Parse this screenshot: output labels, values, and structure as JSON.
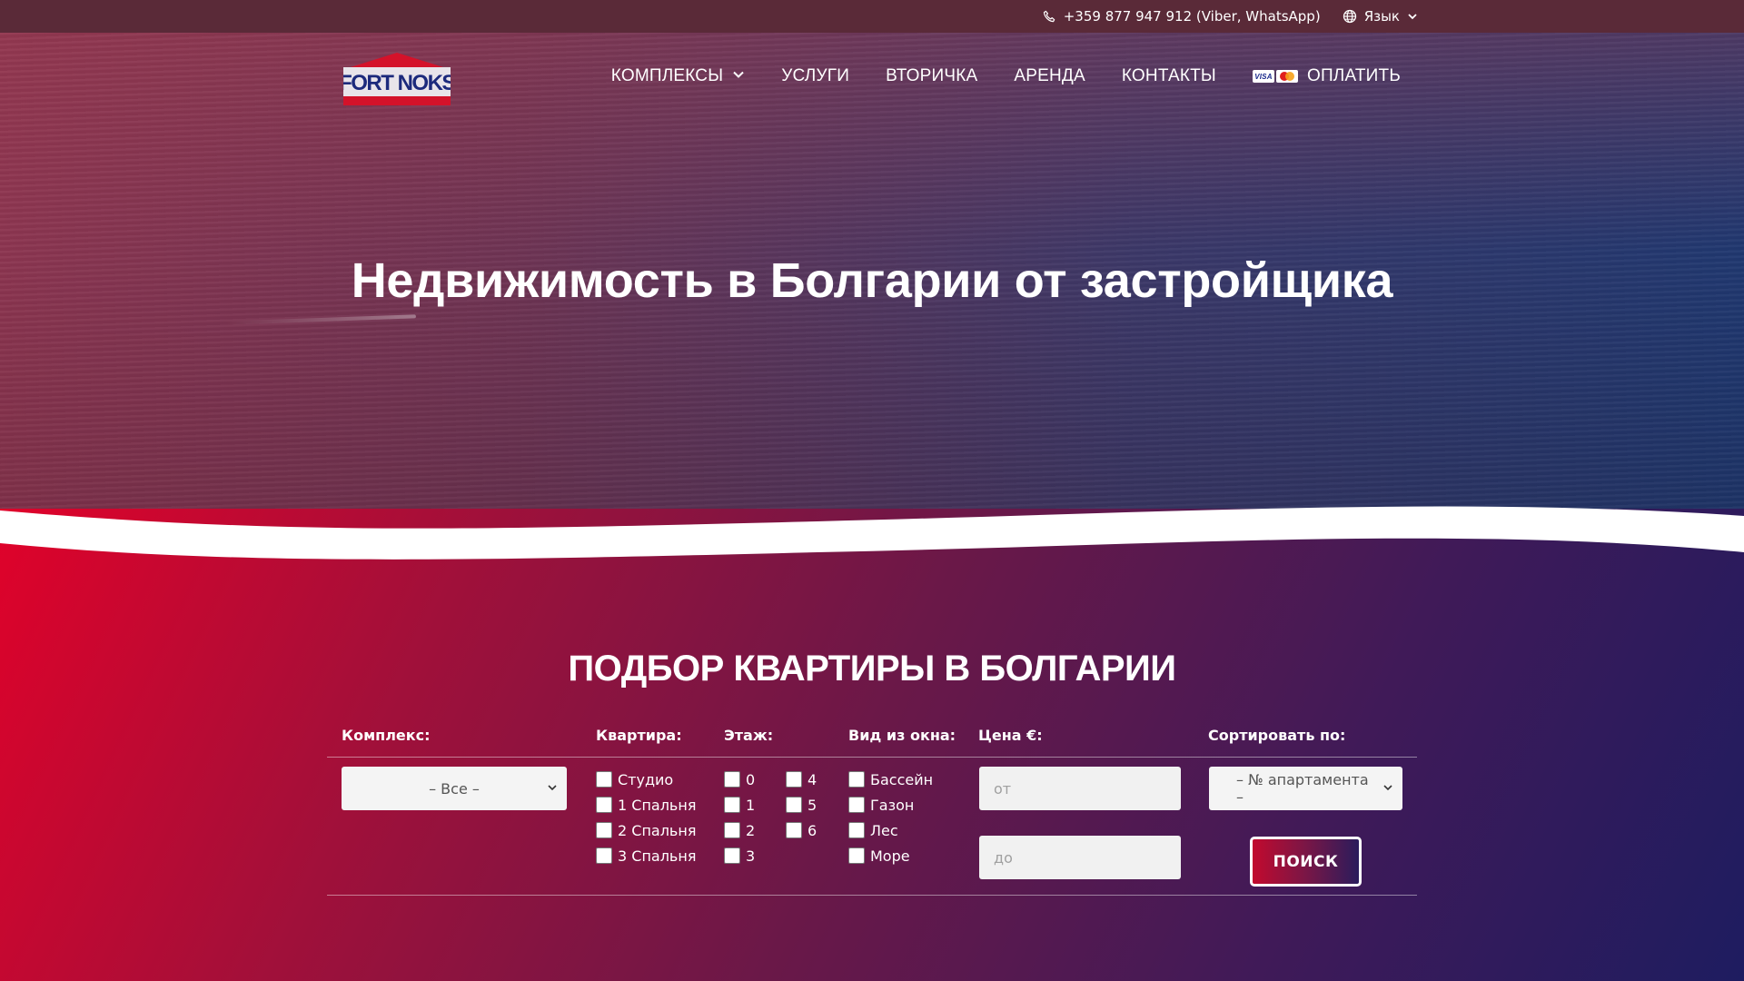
{
  "topbar": {
    "phone": "+359 877 947 912 (Viber, WhatsApp)",
    "language_label": "Язык",
    "icons": [
      "phone-icon",
      "globe-icon",
      "chevron-down-icon"
    ]
  },
  "header": {
    "logo_text": "FORT NOKS",
    "nav": [
      {
        "label": "КОМПЛЕКСЫ",
        "has_dropdown": true
      },
      {
        "label": "УСЛУГИ"
      },
      {
        "label": "ВТОРИЧКА"
      },
      {
        "label": "АРЕНДА"
      },
      {
        "label": "КОНТАКТЫ"
      },
      {
        "label": "ОПЛАТИТЬ",
        "icons": [
          "visa-card-icon",
          "mastercard-icon"
        ]
      }
    ]
  },
  "hero": {
    "title": "Недвижимость в Болгарии от застройщика"
  },
  "search": {
    "title": "ПОДБОР КВАРТИРЫ В БОЛГАРИИ",
    "labels": {
      "complex": "Комплекс:",
      "apartment": "Квартира:",
      "floor": "Этаж:",
      "view": "Вид из окна:",
      "price": "Цена €:",
      "sort": "Сортировать по:"
    },
    "complex_select": "– Все –",
    "apartment_options": [
      "Студио",
      "1 Спальня",
      "2 Спальня",
      "3 Спальня"
    ],
    "floor_options_col1": [
      "0",
      "1",
      "2",
      "3"
    ],
    "floor_options_col2": [
      "4",
      "5",
      "6"
    ],
    "view_options": [
      "Бассейн",
      "Газон",
      "Лес",
      "Море"
    ],
    "price_from_placeholder": "от",
    "price_to_placeholder": "до",
    "sort_select": "– № апартамента –",
    "search_button": "ПОИСК"
  },
  "colors": {
    "topbar": "#5a2a38",
    "accent_red": "#e0022a",
    "accent_navy": "#1e1c60",
    "logo_red": "#d4122a",
    "logo_navy": "#1c2a7c"
  }
}
